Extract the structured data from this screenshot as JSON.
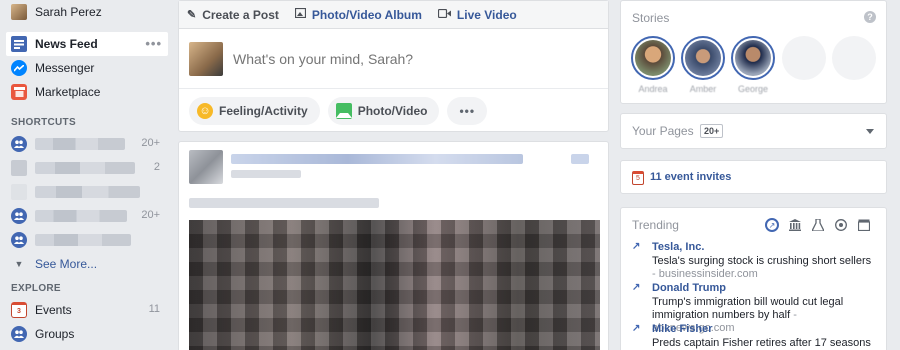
{
  "profile": {
    "name": "Sarah Perez"
  },
  "sidebar": {
    "nav": [
      {
        "label": "News Feed",
        "icon": "news-feed-icon",
        "more": "•••"
      },
      {
        "label": "Messenger",
        "icon": "messenger-icon"
      },
      {
        "label": "Marketplace",
        "icon": "marketplace-icon"
      }
    ],
    "shortcuts_header": "SHORTCUTS",
    "shortcuts": [
      {
        "count": "20+"
      },
      {
        "count": "2"
      },
      {
        "count": ""
      },
      {
        "count": "20+"
      },
      {
        "count": ""
      }
    ],
    "see_more": "See More...",
    "explore_header": "EXPLORE",
    "explore": [
      {
        "label": "Events",
        "count": "11",
        "icon": "calendar-icon"
      },
      {
        "label": "Groups",
        "count": "",
        "icon": "groups-icon"
      }
    ]
  },
  "composer": {
    "tabs": [
      {
        "label": "Create a Post",
        "icon": "pencil-icon"
      },
      {
        "label": "Photo/Video Album",
        "icon": "album-icon"
      },
      {
        "label": "Live Video",
        "icon": "video-camera-icon"
      }
    ],
    "placeholder": "What's on your mind, Sarah?",
    "actions": [
      {
        "label": "Feeling/Activity",
        "icon": "smile-icon"
      },
      {
        "label": "Photo/Video",
        "icon": "photo-icon"
      }
    ],
    "more": "•••"
  },
  "stories": {
    "title": "Stories",
    "help": "?",
    "people": [
      "Andrea",
      "Amber",
      "George"
    ]
  },
  "your_pages": {
    "title": "Your Pages",
    "badge": "20+"
  },
  "events": {
    "label": "11 event invites",
    "calendar_day": "5"
  },
  "trending": {
    "title": "Trending",
    "items": [
      {
        "topic": "Tesla, Inc.",
        "desc": "Tesla's surging stock is crushing short sellers",
        "source": "- businessinsider.com"
      },
      {
        "topic": "Donald Trump",
        "desc": "Trump's immigration bill would cut legal immigration numbers by half",
        "source": "- abcnews.go.com"
      },
      {
        "topic": "Mike Fisher",
        "desc": "Preds captain Fisher retires after 17 seasons",
        "source": ""
      }
    ]
  }
}
